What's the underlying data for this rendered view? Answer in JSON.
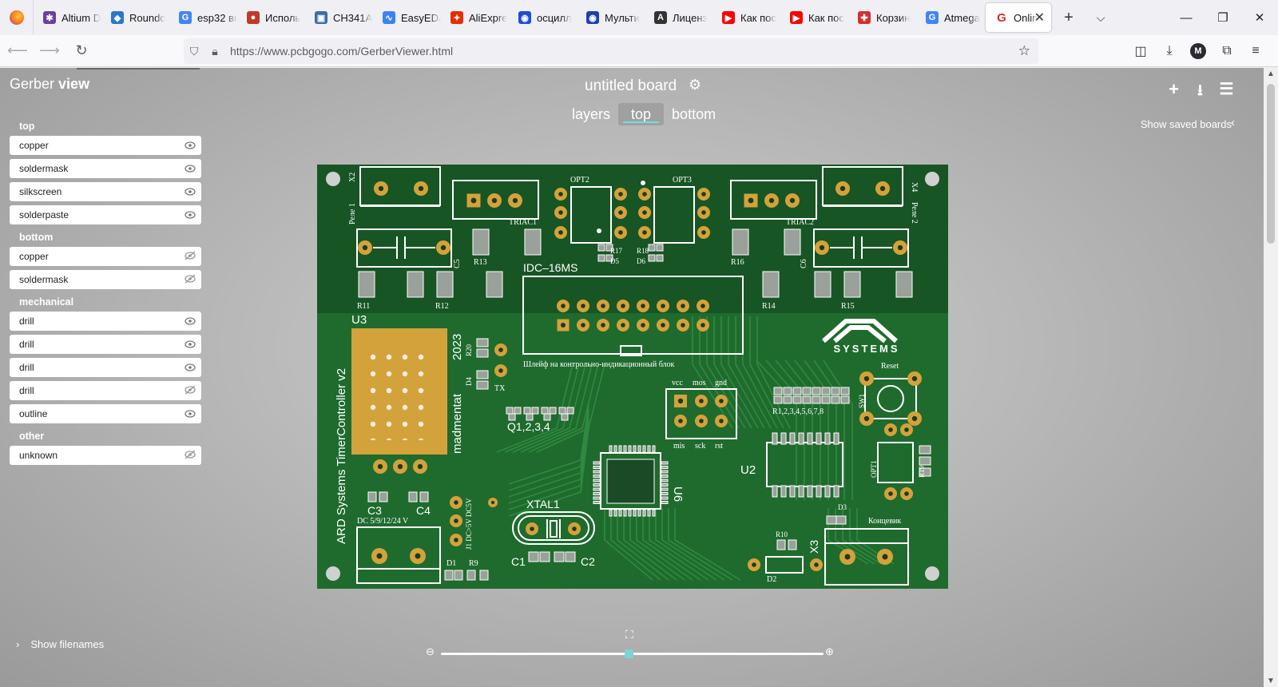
{
  "browser": {
    "tabs": [
      {
        "label": "Altium D",
        "color": "#6b3fa0",
        "glyph": "✱"
      },
      {
        "label": "Roundc",
        "color": "#2a79c8",
        "glyph": "◆"
      },
      {
        "label": "esp32 вн",
        "color": "#4285f4",
        "glyph": "G"
      },
      {
        "label": "Исполь",
        "color": "#c0392b",
        "glyph": "●"
      },
      {
        "label": "CH341A",
        "color": "#3a6ea5",
        "glyph": "▣"
      },
      {
        "label": "EasyEDA",
        "color": "#3b82f6",
        "glyph": "∿"
      },
      {
        "label": "AliExpre",
        "color": "#e62e04",
        "glyph": "✦"
      },
      {
        "label": "осцилл",
        "color": "#1d4ed8",
        "glyph": "◉"
      },
      {
        "label": "Мульти",
        "color": "#1e40af",
        "glyph": "◉"
      },
      {
        "label": "Лиценз",
        "color": "#333333",
        "glyph": "A"
      },
      {
        "label": "Как пос",
        "color": "#ff0000",
        "glyph": "▶"
      },
      {
        "label": "Как пос",
        "color": "#ff0000",
        "glyph": "▶"
      },
      {
        "label": "Корзин",
        "color": "#d32f2f",
        "glyph": "✚"
      },
      {
        "label": "Atmega",
        "color": "#4285f4",
        "glyph": "G"
      }
    ],
    "active_tab": {
      "label": "Onlin",
      "color": "#d93025",
      "glyph": "G"
    },
    "url": "https://www.pcbgogo.com/GerberViewer.html"
  },
  "app": {
    "brand_light": "Gerber",
    "brand_bold": "view",
    "board_title": "untitled board",
    "view_tabs": {
      "layers": "layers",
      "top": "top",
      "bottom": "bottom"
    },
    "show_saved_boards": "Show saved boards",
    "show_filenames": "Show filenames",
    "zoom_level_fraction": 0.49
  },
  "sidebar": {
    "sections": [
      {
        "title": "top",
        "items": [
          {
            "label": "copper",
            "visible": true
          },
          {
            "label": "soldermask",
            "visible": true
          },
          {
            "label": "silkscreen",
            "visible": true
          },
          {
            "label": "solderpaste",
            "visible": true
          }
        ]
      },
      {
        "title": "bottom",
        "items": [
          {
            "label": "copper",
            "visible": false
          },
          {
            "label": "soldermask",
            "visible": false
          }
        ]
      },
      {
        "title": "mechanical",
        "items": [
          {
            "label": "drill",
            "visible": true
          },
          {
            "label": "drill",
            "visible": true
          },
          {
            "label": "drill",
            "visible": true
          },
          {
            "label": "drill",
            "visible": false
          },
          {
            "label": "outline",
            "visible": true
          }
        ]
      },
      {
        "title": "other",
        "items": [
          {
            "label": "unknown",
            "visible": false
          }
        ]
      }
    ]
  },
  "pcb": {
    "colors": {
      "board": "#1f6b2e",
      "board_dark": "#175524",
      "pad": "#d4a23a",
      "silk": "#ffffff"
    },
    "silk_labels": {
      "x2": "X2",
      "rele1": "Реле 1",
      "opt2": "OPT2",
      "opt3": "OPT3",
      "x4": "X4",
      "rele2": "Реле 2",
      "triac1": "TRIAC1",
      "triac2": "TRIAC2",
      "r13": "R13",
      "r17": "R17",
      "d5": "D5",
      "r18": "R18",
      "d6": "D6",
      "r16": "R16",
      "c5": "C5",
      "c6": "C6",
      "idc": "IDC–16MS",
      "r11": "R11",
      "r12": "R12",
      "r14": "R14",
      "r15": "R15",
      "u3": "U3",
      "year": "2023",
      "r20": "R20",
      "d4": "D4",
      "tx": "TX",
      "ribbon": "Шлейф на контрольно-индикационный блок",
      "vcc": "vcc",
      "mos": "mos",
      "gnd": "gnd",
      "mis": "mis",
      "sck": "sck",
      "rst": "rst",
      "rlist": "R1,2,3,4,5,6,7,8",
      "reset": "Reset",
      "sw1": "SW1",
      "q": "Q1,2,3,4",
      "author": "madmentat",
      "tc": "ARD Systems TimerController v2",
      "u2": "U2",
      "u6": "U6",
      "opt1": "OPT1",
      "r19": "R19",
      "c3": "C3",
      "c4": "C4",
      "dc": "DC 5/9/12/24 V",
      "xtal": "XTAL1",
      "j1": "J1 DC>5V DC5V",
      "d3": "D3",
      "limit": "Концевик",
      "r10": "R10",
      "x3": "X3",
      "d1": "D1",
      "r9": "R9",
      "c1": "C1",
      "c2": "C2",
      "d2": "D2",
      "logo": "SYSTEMS"
    }
  }
}
